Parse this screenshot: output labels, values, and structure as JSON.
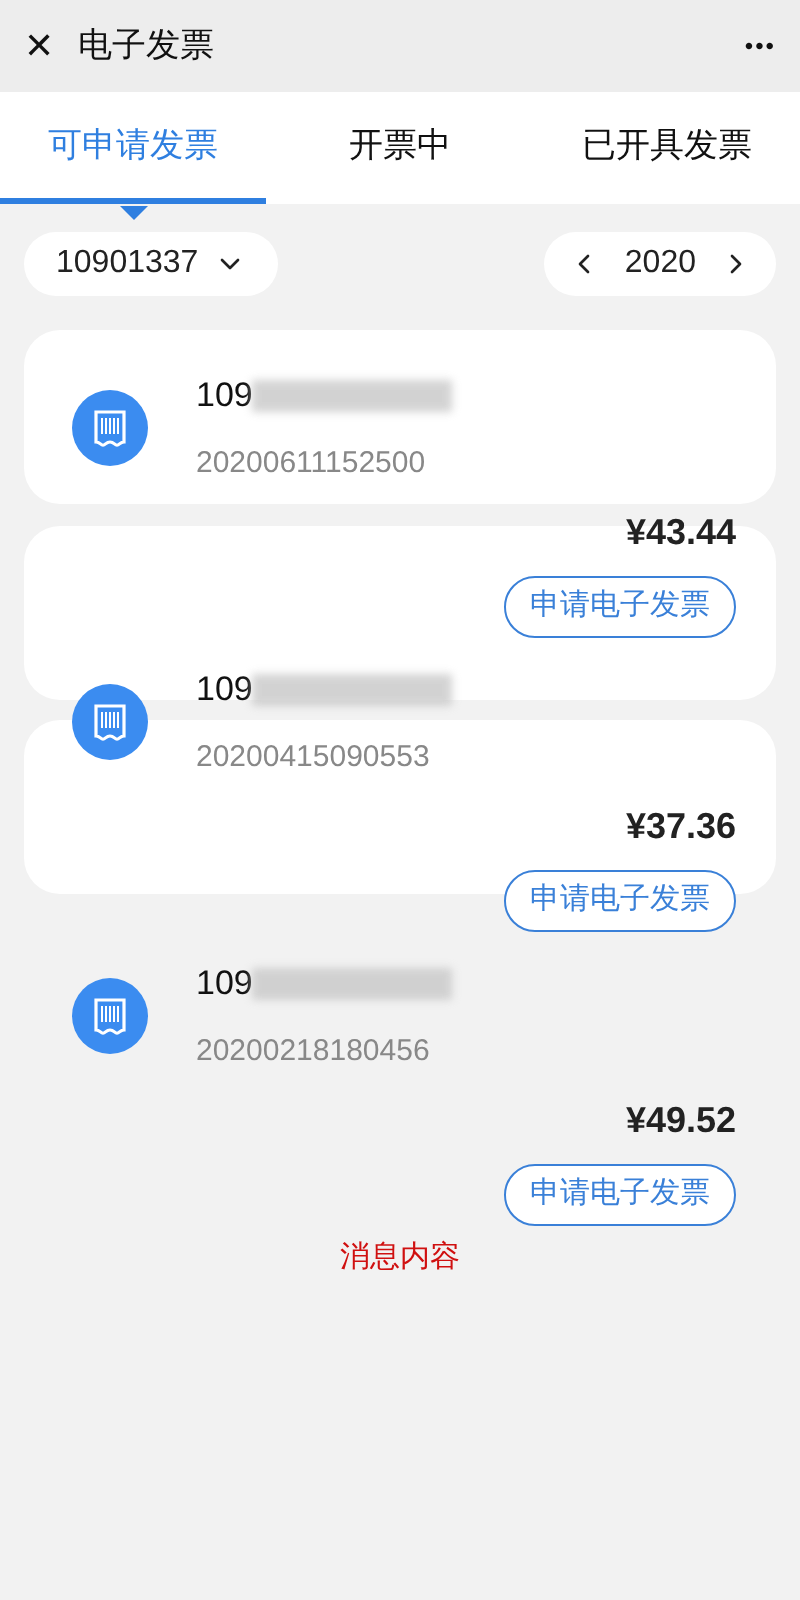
{
  "header": {
    "close": "✕",
    "title": "电子发票",
    "more": "•••"
  },
  "tabs": [
    {
      "label": "可申请发票",
      "selected": true
    },
    {
      "label": "开票中",
      "selected": false
    },
    {
      "label": "已开具发票",
      "selected": false
    }
  ],
  "filter": {
    "account": "10901337",
    "year": "2020"
  },
  "records": [
    {
      "name": "109",
      "number": "20200611152500",
      "amount": "¥43.44",
      "button": "申请电子发票"
    },
    {
      "name": "109",
      "number": "20200415090553",
      "amount": "¥37.36",
      "button": "申请电子发票"
    },
    {
      "name": "109",
      "number": "20200218180456",
      "amount": "¥49.52",
      "button": "申请电子发票"
    }
  ],
  "message": "消息内容"
}
